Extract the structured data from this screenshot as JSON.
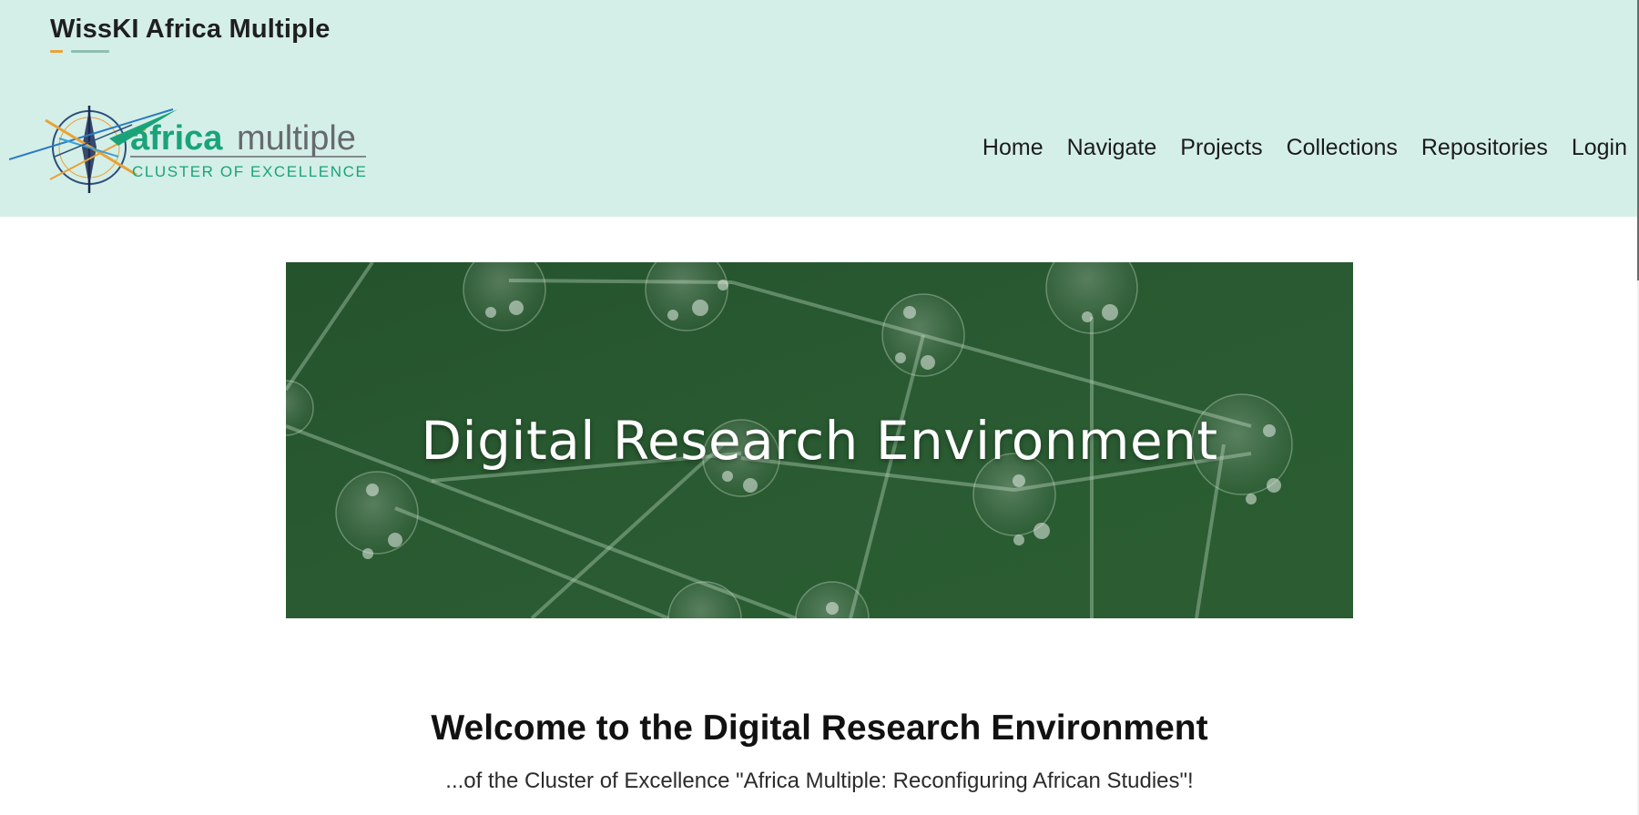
{
  "header": {
    "site_name": "WissKI Africa Multiple",
    "logo": {
      "wordmark_part1": "africa",
      "wordmark_part2": "multiple",
      "tagline": "CLUSTER OF EXCELLENCE"
    },
    "nav": [
      {
        "label": "Home"
      },
      {
        "label": "Navigate"
      },
      {
        "label": "Projects"
      },
      {
        "label": "Collections"
      },
      {
        "label": "Repositories"
      },
      {
        "label": "Login"
      }
    ]
  },
  "hero": {
    "title": "Digital Research Environment"
  },
  "main": {
    "welcome_title": "Welcome to the Digital Research Environment",
    "welcome_subtitle": "...of the Cluster of Excellence \"Africa Multiple: Reconfiguring African Studies\"!"
  },
  "colors": {
    "header_bg": "#d4efe7",
    "hero_bg": "#285a30",
    "accent_orange": "#e8a23a",
    "accent_teal": "#1aa37a",
    "logo_grey": "#666a6d"
  }
}
